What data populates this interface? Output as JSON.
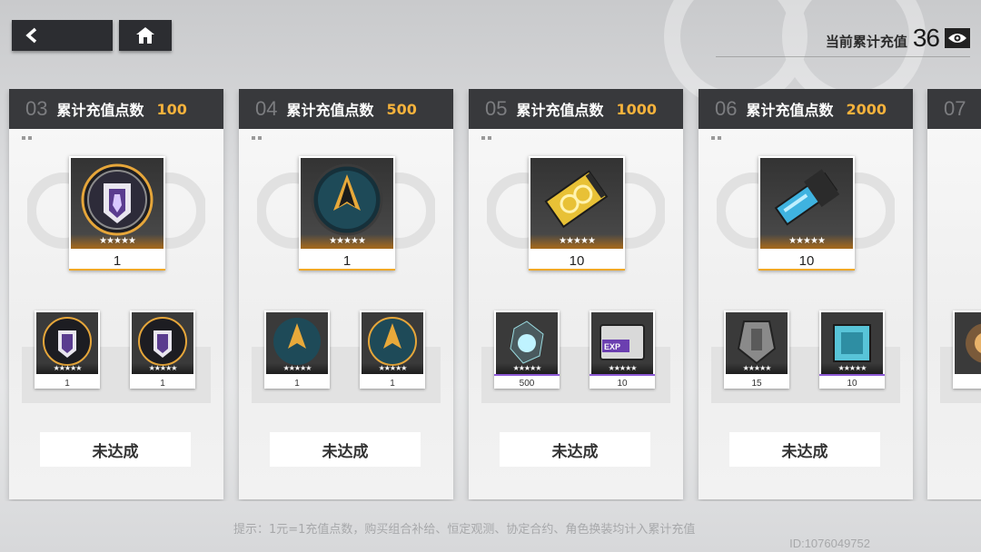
{
  "header": {
    "recharge_label": "当前累计充值",
    "recharge_value": "36"
  },
  "cards": [
    {
      "index": "03",
      "title": "累计充值点数",
      "points": "100",
      "main_qty": "1",
      "sub_qtys": [
        "1",
        "1"
      ],
      "status": "未达成",
      "main_icon": "emblem-icon",
      "sub_icons": [
        "emblem-icon",
        "emblem-icon"
      ]
    },
    {
      "index": "04",
      "title": "累计充值点数",
      "points": "500",
      "main_qty": "1",
      "sub_qtys": [
        "1",
        "1"
      ],
      "status": "未达成",
      "main_icon": "arrowhead-emblem-icon",
      "sub_icons": [
        "arrowhead-emblem-icon",
        "arrowhead-emblem-icon"
      ]
    },
    {
      "index": "05",
      "title": "累计充值点数",
      "points": "1000",
      "main_qty": "10",
      "sub_qtys": [
        "500",
        "10"
      ],
      "status": "未达成",
      "main_icon": "gold-ticket-icon",
      "sub_icons": [
        "crystal-orb-icon",
        "exp-device-icon"
      ]
    },
    {
      "index": "06",
      "title": "累计充值点数",
      "points": "2000",
      "main_qty": "10",
      "sub_qtys": [
        "15",
        "10"
      ],
      "status": "未达成",
      "main_icon": "blue-module-icon",
      "sub_icons": [
        "armor-plate-icon",
        "cube-module-icon"
      ]
    },
    {
      "index": "07",
      "title": "",
      "points": "",
      "main_qty": "",
      "sub_qtys": [
        ""
      ],
      "status": "",
      "main_icon": "",
      "sub_icons": [
        "orb-icon"
      ]
    }
  ],
  "stars_label": "★★★★★",
  "footer": {
    "hint": "提示：1元=1充值点数，购买组合补给、恒定观测、协定合约、角色换装均计入累计充值",
    "uid": "ID:1076049752"
  },
  "colors": {
    "accent_gold": "#f5b23c",
    "header_bg": "#38393c",
    "purple_bar": "#8e5bd6",
    "gold_bar": "#f0a928"
  }
}
